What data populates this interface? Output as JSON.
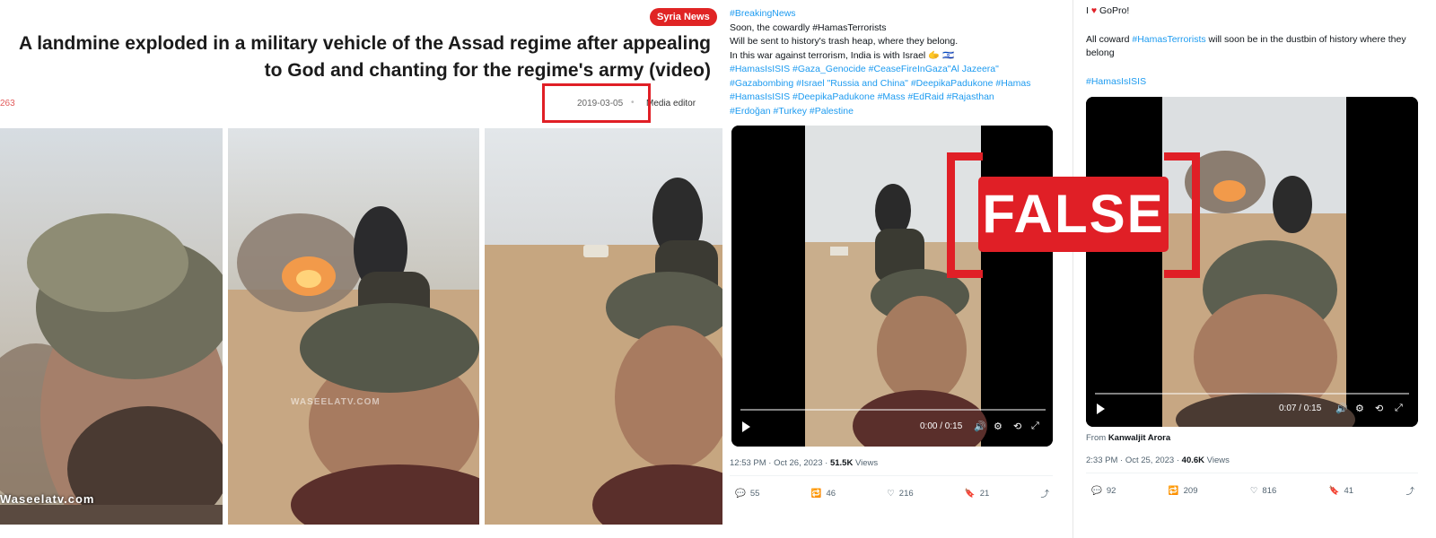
{
  "article": {
    "category_badge": "Syria News",
    "headline_line1": "A landmine exploded in a military vehicle of the Assad regime after appealing",
    "headline_line2": "to God and chanting for the regime's army (video)",
    "view_count": "263",
    "date": "2019-03-05",
    "author": "Media editor",
    "watermark_main": "Waseelatv.com",
    "watermark_center": "WASEELATV.COM"
  },
  "tweet1": {
    "lines": [
      "#BreakingNews",
      "Soon, the cowardly #HamasTerrorists",
      "Will be sent to history's trash heap, where they belong.",
      "In this war against terrorism, India is with Israel 🫱 🇮🇱",
      "#HamasIsISIS #Gaza_Genocide #CeaseFireInGaza\"Al Jazeera\"",
      "#Gazabombing #Israel \"Russia and China\" #DeepikaPadukone #Hamas",
      "#HamasIsISIS #DeepikaPadukone #Mass #EdRaid #Rajasthan",
      "#Erdoğan #Turkey #Palestine"
    ],
    "video_time": "0:00 / 0:15",
    "timestamp": "12:53 PM · Oct 26, 2023 · ",
    "views_count": "51.5K",
    "views_label": " Views",
    "replies": "55",
    "reposts": "46",
    "likes": "216",
    "bookmarks": "21"
  },
  "tweet2": {
    "line1_pre": "I ",
    "line1_post": " GoPro!",
    "line2_pre": "All coward ",
    "line2_tag": "#HamasTerrorists",
    "line2_post": " will soon be in the dustbin of history where they belong",
    "hashtag": "#HamasIsISIS",
    "video_time": "0:07 / 0:15",
    "from_label": "From ",
    "from_name": "Kanwaljit Arora",
    "timestamp": "2:33 PM · Oct 25, 2023 · ",
    "views_count": "40.6K",
    "views_label": " Views",
    "replies": "92",
    "reposts": "209",
    "likes": "816",
    "bookmarks": "41"
  },
  "stamp": {
    "label": "FALSE",
    "color": "#e01f26"
  },
  "colors": {
    "link": "#1d9bf0",
    "badge": "#e02424",
    "highlight_box": "#e01f26"
  }
}
